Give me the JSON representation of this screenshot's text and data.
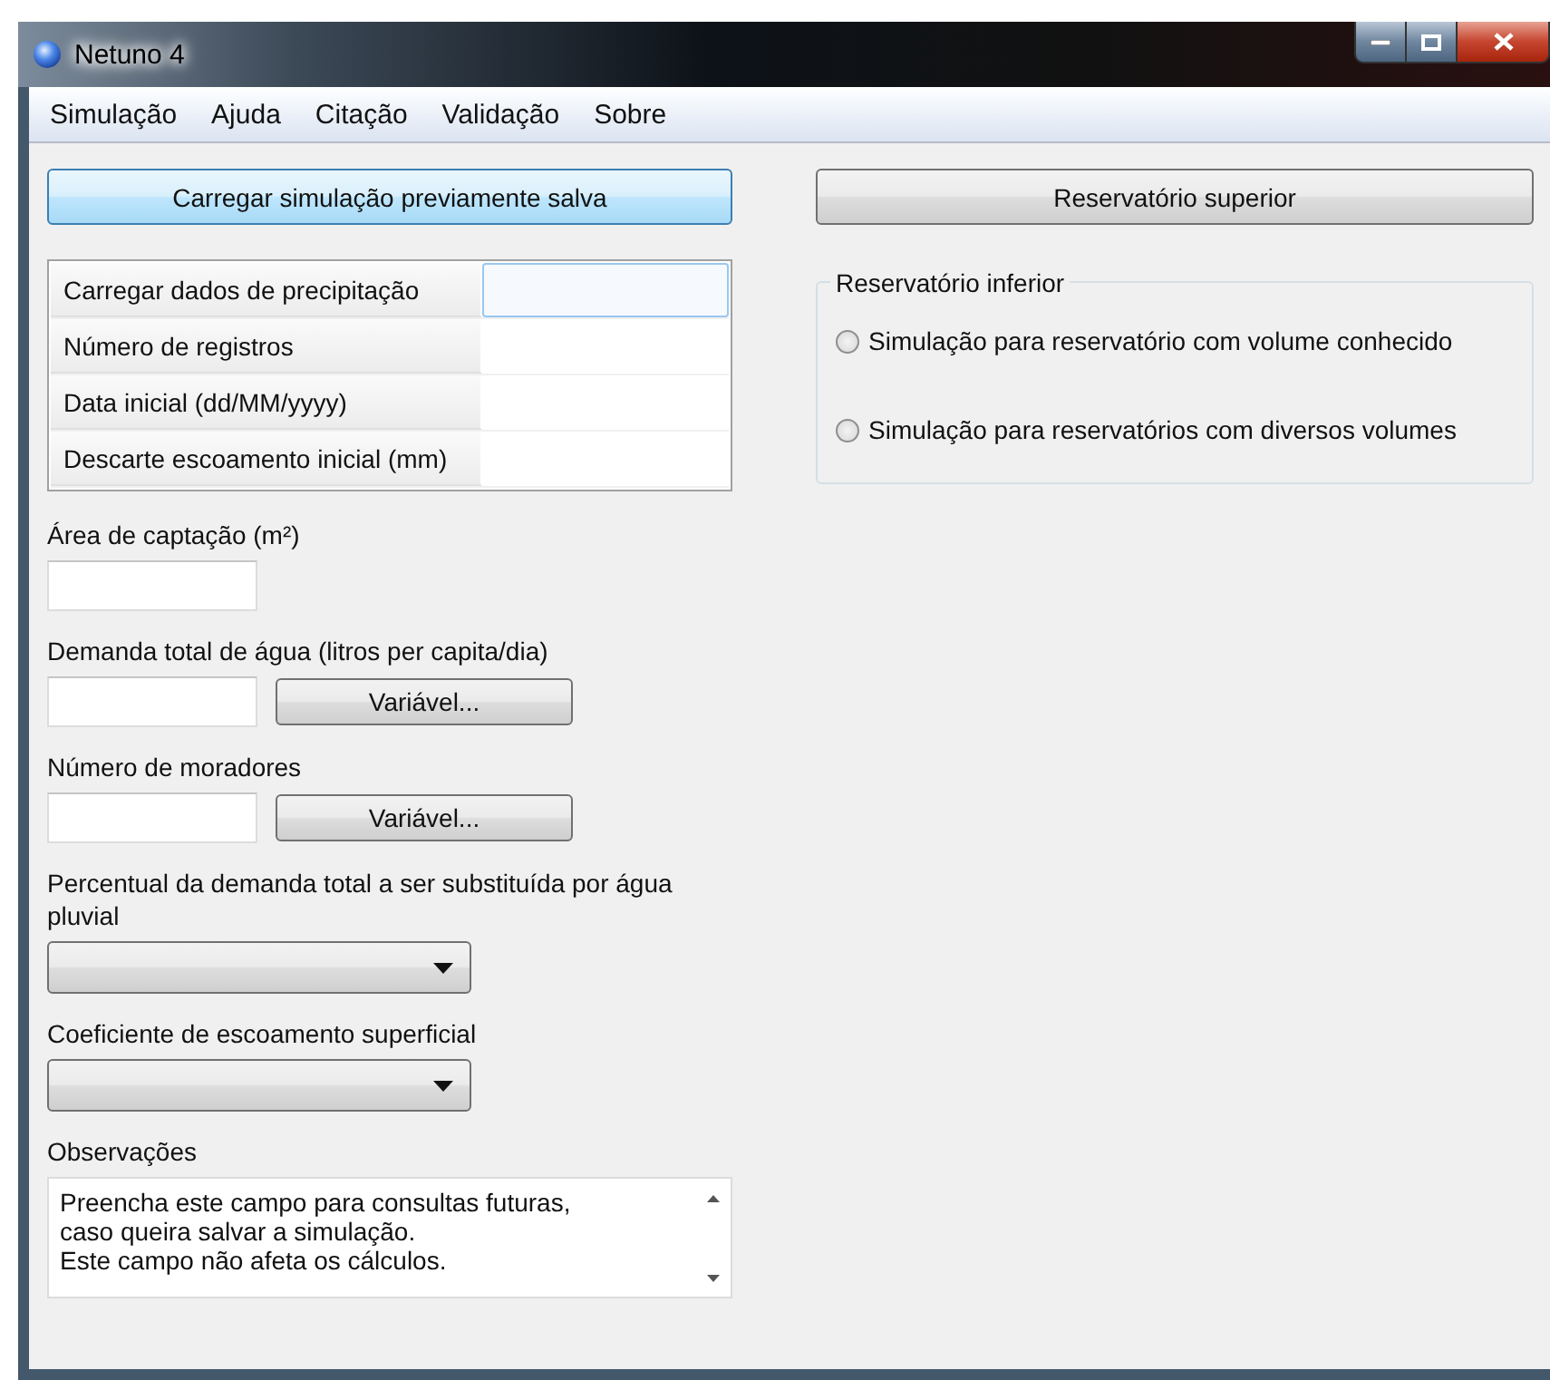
{
  "window": {
    "title": "Netuno 4"
  },
  "menu": [
    "Simulação",
    "Ajuda",
    "Citação",
    "Validação",
    "Sobre"
  ],
  "load_button": "Carregar simulação previamente salva",
  "input_table": [
    {
      "label": "Carregar dados de precipitação",
      "focused": true
    },
    {
      "label": "Número de registros",
      "focused": false
    },
    {
      "label": "Data inicial (dd/MM/yyyy)",
      "focused": false
    },
    {
      "label": "Descarte escoamento inicial (mm)",
      "focused": false
    }
  ],
  "fields": [
    {
      "kind": "text",
      "label": "Área de captação (m²)"
    },
    {
      "kind": "text_button",
      "label": "Demanda total de água (litros per capita/dia)",
      "button": "Variável..."
    },
    {
      "kind": "text_button",
      "label": "Número de moradores",
      "button": "Variável..."
    },
    {
      "kind": "combo",
      "label": "Percentual da demanda total a ser substituída por água pluvial"
    },
    {
      "kind": "combo",
      "label": "Coeficiente de escoamento superficial"
    },
    {
      "kind": "memo",
      "label": "Observações",
      "value": "Preencha este campo para consultas futuras,\ncaso queira salvar a simulação.\nEste campo não afeta os cálculos."
    }
  ],
  "upper_button": "Reservatório superior",
  "lower_group": {
    "title": "Reservatório inferior",
    "options": [
      {
        "label": "Simulação para reservatório com volume conhecido",
        "selected": false
      },
      {
        "label": "Simulação para reservatórios com diversos volumes",
        "selected": false
      }
    ]
  }
}
